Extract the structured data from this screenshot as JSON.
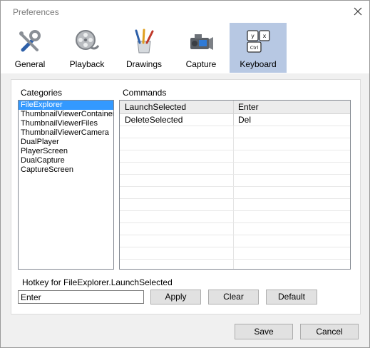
{
  "window": {
    "title": "Preferences"
  },
  "tabs": [
    {
      "label": "General",
      "icon": "tools-icon"
    },
    {
      "label": "Playback",
      "icon": "film-reel-icon"
    },
    {
      "label": "Drawings",
      "icon": "brushes-icon"
    },
    {
      "label": "Capture",
      "icon": "camera-icon"
    },
    {
      "label": "Keyboard",
      "icon": "keyboard-icon",
      "active": true
    }
  ],
  "categories": {
    "label": "Categories",
    "items": [
      "FileExplorer",
      "ThumbnailViewerContainer",
      "ThumbnailViewerFiles",
      "ThumbnailViewerCamera",
      "DualPlayer",
      "PlayerScreen",
      "DualCapture",
      "CaptureScreen"
    ],
    "selected": "FileExplorer"
  },
  "commands": {
    "label": "Commands",
    "rows": [
      {
        "command": "LaunchSelected",
        "key": "Enter"
      },
      {
        "command": "DeleteSelected",
        "key": "Del"
      }
    ]
  },
  "hotkey": {
    "label": "Hotkey for FileExplorer.LaunchSelected",
    "value": "Enter",
    "apply_label": "Apply",
    "clear_label": "Clear",
    "default_label": "Default"
  },
  "footer": {
    "save_label": "Save",
    "cancel_label": "Cancel"
  },
  "colors": {
    "active_tab": "#b7c8e3",
    "selection": "#3399ff"
  }
}
